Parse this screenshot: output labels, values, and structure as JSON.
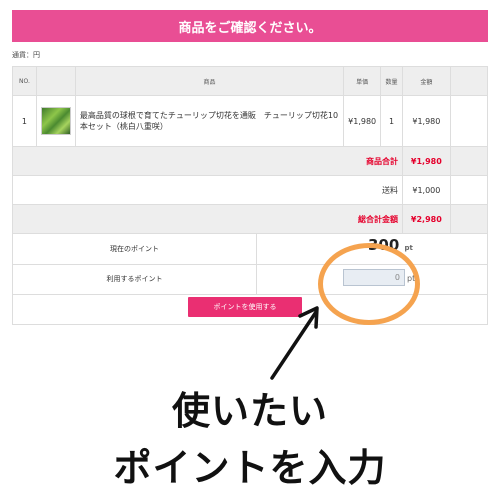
{
  "banner": {
    "title": "商品をご確認ください。"
  },
  "currency_note": "通貨：円",
  "cart": {
    "headers": {
      "no": "NO.",
      "image": "",
      "product": "商品",
      "unit_price": "単価",
      "qty": "数量",
      "amount": "金額"
    },
    "items": [
      {
        "no": "1",
        "name": "最高品質の球根で育てたチューリップ切花を通販　チューリップ切花10本セット（桃白八重咲）",
        "unit_price": "¥1,980",
        "qty": "1",
        "amount": "¥1,980"
      }
    ],
    "subtotal": {
      "label": "商品合計",
      "value": "¥1,980"
    },
    "shipping": {
      "label": "送料",
      "value": "¥1,000"
    },
    "total": {
      "label": "総合計金額",
      "value": "¥2,980"
    }
  },
  "points": {
    "current_label": "現在のポイント",
    "current_value": "300",
    "current_unit": "pt",
    "use_label": "利用するポイント",
    "use_value": "0",
    "use_unit": "pt",
    "button_label": "ポイントを使用する"
  },
  "annotation": {
    "line1": "使いたい",
    "line2": "ポイントを入力",
    "color_circle": "#f5a34f"
  },
  "colors": {
    "accent_pink": "#e94e94",
    "button_pink": "#ea2f72",
    "red": "#e5002c"
  }
}
